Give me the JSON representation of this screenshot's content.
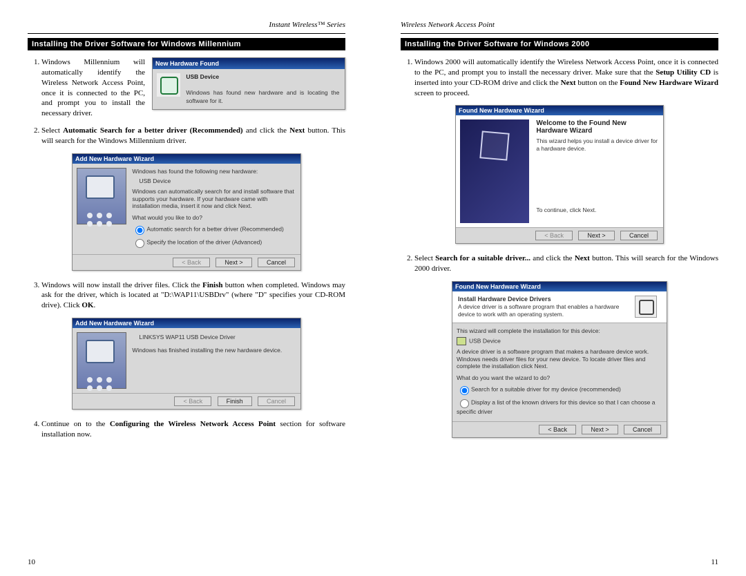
{
  "left": {
    "header": "Instant Wireless™ Series",
    "section_title": "Installing the Driver Software for Windows Millennium",
    "step1": "Windows Millennium will automatically identify the Wireless Network Access Point, once it is connected to the PC, and prompt you to install the necessary driver.",
    "step2_a": "Select ",
    "step2_b": "Automatic Search for a better driver (Recommended)",
    "step2_c": " and click the ",
    "step2_d": "Next",
    "step2_e": " button. This will search for the Windows Millennium driver.",
    "step3_a": "Windows will now install the driver files. Click the ",
    "step3_b": "Finish",
    "step3_c": " button when completed. Windows may ask for the driver, which is located at \"D:\\WAP11\\USBDrv\" (where \"D\" specifies your CD-ROM drive). Click ",
    "step3_d": "OK",
    "step3_e": ".",
    "step4_a": "Continue on to the ",
    "step4_b": "Configuring the Wireless Network Access Point",
    "step4_c": " section for software installation now.",
    "page_number": "10",
    "fig1": {
      "title": "New Hardware Found",
      "device": "USB Device",
      "msg": "Windows has found new hardware and is locating the software for it."
    },
    "fig2": {
      "title": "Add New Hardware Wizard",
      "line1": "Windows has found the following new hardware:",
      "device": "USB Device",
      "line2": "Windows can automatically search for and install software that supports your hardware. If your hardware came with installation media, insert it now and click Next.",
      "prompt": "What would you like to do?",
      "opt1": "Automatic search for a better driver (Recommended)",
      "opt2": "Specify the location of the driver (Advanced)",
      "back": "< Back",
      "next": "Next >",
      "cancel": "Cancel"
    },
    "fig3": {
      "title": "Add New Hardware Wizard",
      "device": "LINKSYS WAP11 USB Device Driver",
      "msg": "Windows has finished installing the new hardware device.",
      "back": "< Back",
      "finish": "Finish",
      "cancel": "Cancel"
    }
  },
  "right": {
    "header": "Wireless Network Access Point",
    "section_title": "Installing the Driver Software for Windows 2000",
    "step1_a": "Windows 2000 will automatically identify the Wireless Network Access Point, once it is connected to the PC, and prompt you to install the necessary driver. Make sure that the ",
    "step1_b": "Setup Utility CD",
    "step1_c": " is inserted into your CD-ROM drive and click the ",
    "step1_d": "Next",
    "step1_e": " button on the ",
    "step1_f": "Found New Hardware Wizard",
    "step1_g": " screen to proceed.",
    "step2_a": "Select ",
    "step2_b": "Search for a suitable driver...",
    "step2_c": " and click the ",
    "step2_d": "Next",
    "step2_e": " button. This will search for the Windows 2000 driver.",
    "page_number": "11",
    "fig1": {
      "title": "Found New Hardware Wizard",
      "welcome": "Welcome to the Found New Hardware Wizard",
      "msg": "This wizard helps you install a device driver for a hardware device.",
      "cont": "To continue, click Next.",
      "back": "< Back",
      "next": "Next >",
      "cancel": "Cancel"
    },
    "fig2": {
      "title": "Found New Hardware Wizard",
      "heading": "Install Hardware Device Drivers",
      "sub": "A device driver is a software program that enables a hardware device to work with an operating system.",
      "line1": "This wizard will complete the installation for this device:",
      "device": "USB Device",
      "line2": "A device driver is a software program that makes a hardware device work. Windows needs driver files for your new device. To locate driver files and complete the installation click Next.",
      "prompt": "What do you want the wizard to do?",
      "opt1": "Search for a suitable driver for my device (recommended)",
      "opt2": "Display a list of the known drivers for this device so that I can choose a specific driver",
      "back": "< Back",
      "next": "Next >",
      "cancel": "Cancel"
    }
  }
}
